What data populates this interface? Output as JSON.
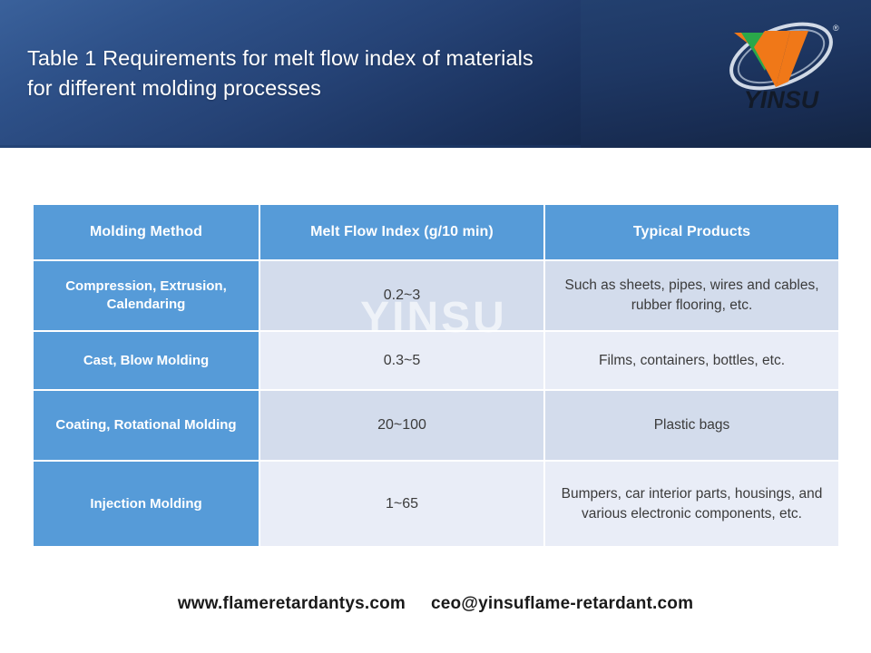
{
  "header": {
    "title": "Table 1 Requirements for melt flow index of materials for different molding processes",
    "brand_name": "YINSU",
    "banner_gradient_from": "#3a619b",
    "banner_gradient_to": "#142542"
  },
  "logo": {
    "name": "yinsu-logo",
    "wordmark": "YINSU",
    "green_hex": "#2aa84a",
    "orange_hex": "#f07818",
    "swoosh_hex": "#dde4ef",
    "registered_mark": "®"
  },
  "table": {
    "accent_hex": "#569bd8",
    "row_shade_dark_hex": "#d3dcec",
    "row_shade_light_hex": "#e9edf7",
    "columns": [
      "Molding Method",
      "Melt Flow Index (g/10 min)",
      "Typical Products"
    ],
    "rows": [
      {
        "method": "Compression, Extrusion, Calendaring",
        "mfi": "0.2~3",
        "products": "Such as sheets, pipes, wires and cables, rubber flooring, etc."
      },
      {
        "method": "Cast, Blow Molding",
        "mfi": "0.3~5",
        "products": "Films, containers, bottles, etc."
      },
      {
        "method": "Coating, Rotational Molding",
        "mfi": "20~100",
        "products": "Plastic bags"
      },
      {
        "method": "Injection Molding",
        "mfi": "1~65",
        "products": "Bumpers, car interior parts, housings, and various electronic components, etc."
      }
    ]
  },
  "watermark": {
    "text": "YINSU"
  },
  "footer": {
    "website": "www.flameretardantys.com",
    "email": "ceo@yinsuflame-retardant.com"
  }
}
